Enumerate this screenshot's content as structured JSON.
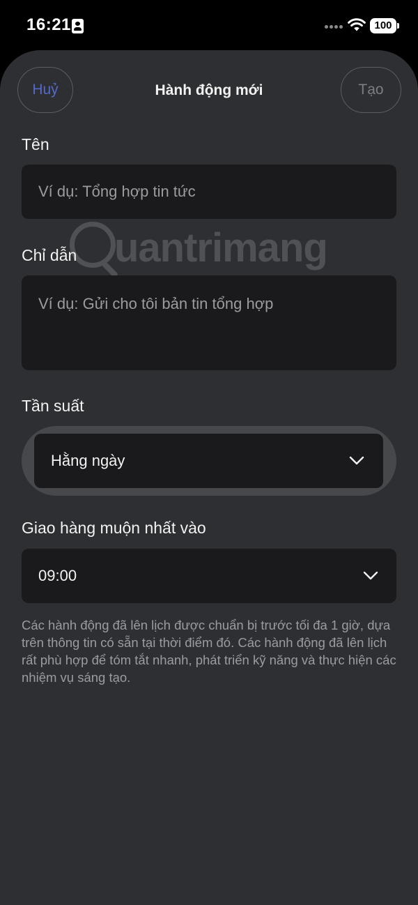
{
  "status_bar": {
    "time": "16:21",
    "battery": "100"
  },
  "header": {
    "cancel_label": "Huỷ",
    "title": "Hành động mới",
    "create_label": "Tạo"
  },
  "form": {
    "name": {
      "label": "Tên",
      "placeholder": "Ví dụ: Tổng hợp tin tức"
    },
    "instructions": {
      "label": "Chỉ dẫn",
      "placeholder": "Ví dụ: Gửi cho tôi bản tin tổng hợp"
    },
    "frequency": {
      "label": "Tần suất",
      "value": "Hằng ngày"
    },
    "delivery": {
      "label": "Giao hàng muộn nhất vào",
      "value": "09:00"
    },
    "note": "Các hành động đã lên lịch được chuẩn bị trước tối đa 1 giờ, dựa trên thông tin có sẵn tại thời điểm đó. Các hành động đã lên lịch rất phù hợp để tóm tắt nhanh, phát triển kỹ năng và thực hiện các nhiệm vụ sáng tạo."
  },
  "watermark": {
    "text": "uantrimang"
  },
  "icons": {
    "wifi": "wifi-icon",
    "battery": "battery-icon",
    "id_card": "id-card-icon",
    "chevron": "chevron-down-icon"
  },
  "colors": {
    "sheet_bg": "#2e2f32",
    "input_bg": "#1a1a1c",
    "cancel_accent": "#5469c9"
  }
}
